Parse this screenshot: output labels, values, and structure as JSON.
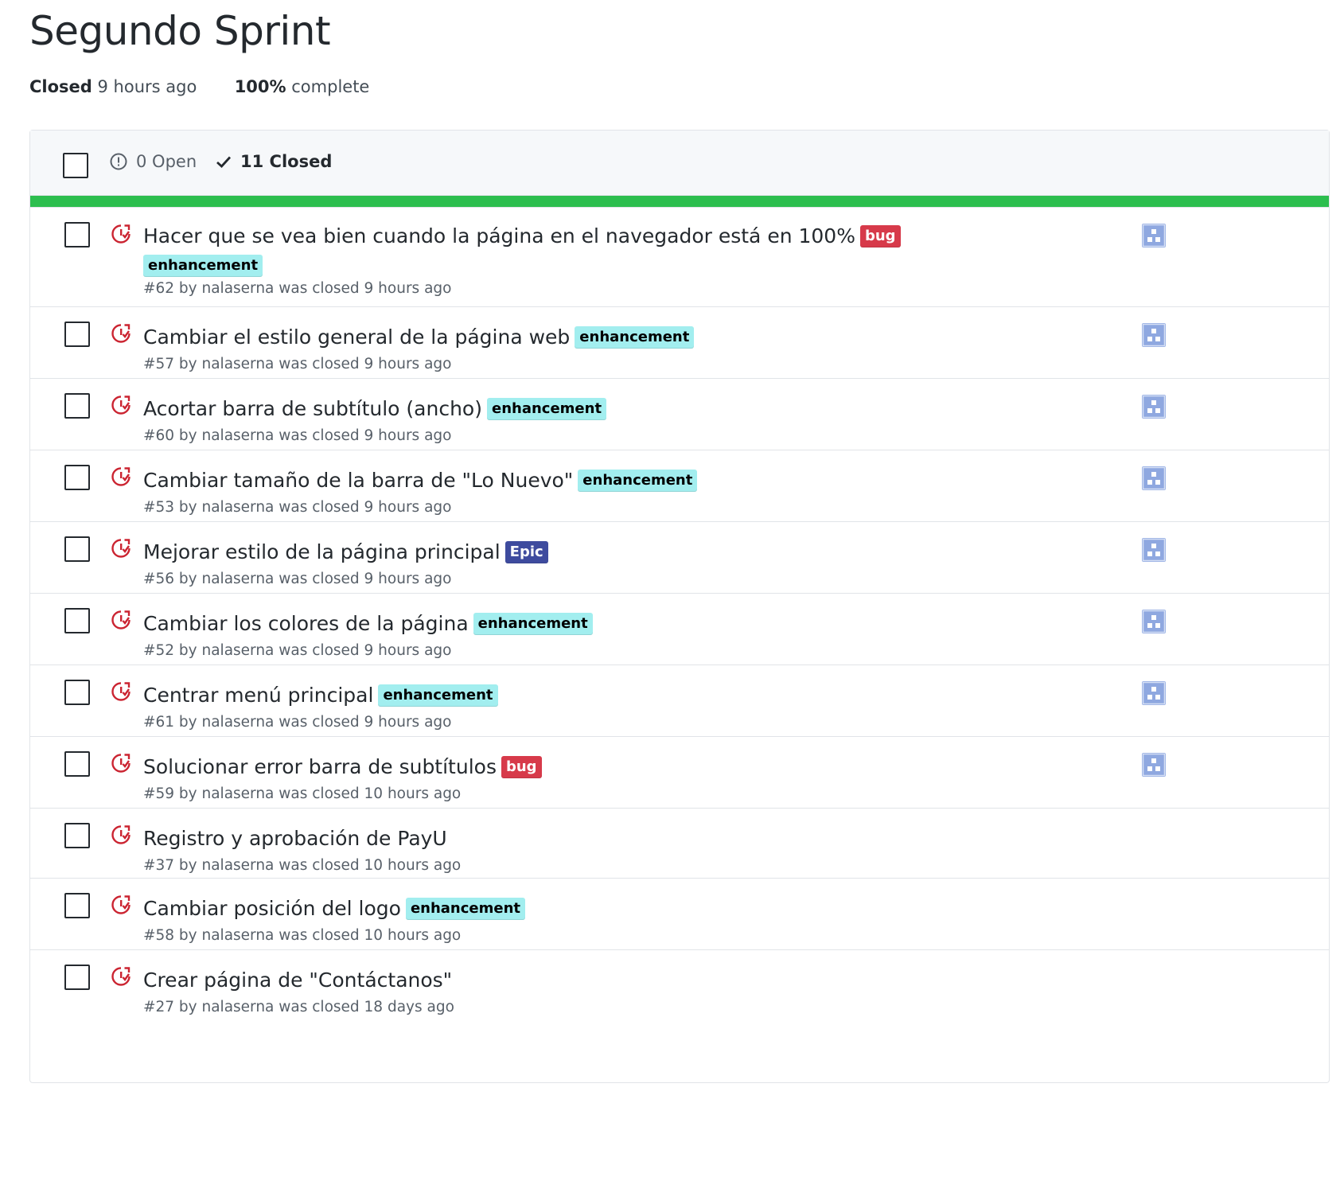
{
  "milestone": {
    "title": "Segundo Sprint",
    "status_label": "Closed",
    "status_time": "9 hours ago",
    "percent_label": "100%",
    "percent_suffix": "complete",
    "progress": 1.0
  },
  "header": {
    "open_label": "0 Open",
    "closed_label": "11 Closed"
  },
  "colors": {
    "progress": "#2cbe4e",
    "closed_icon": "#cb2431",
    "bug_bg": "#d73a4a",
    "bug_fg": "#ffffff",
    "enhancement_bg": "#a2eeef",
    "enhancement_fg": "#000000",
    "epic_bg": "#3e4b9e",
    "epic_fg": "#ffffff"
  },
  "issues": [
    {
      "title": "Hacer que se vea bien cuando la página en el navegador está en 100%",
      "labels": [
        "bug",
        "enhancement"
      ],
      "subtitle": "#62 by nalaserna was closed 9 hours ago",
      "assignee_icon": "identicon-avatar"
    },
    {
      "title": "Cambiar el estilo general de la página web",
      "labels": [
        "enhancement"
      ],
      "subtitle": "#57 by nalaserna was closed 9 hours ago",
      "assignee_icon": "identicon-avatar"
    },
    {
      "title": "Acortar barra de subtítulo (ancho)",
      "labels": [
        "enhancement"
      ],
      "subtitle": "#60 by nalaserna was closed 9 hours ago",
      "assignee_icon": "identicon-avatar"
    },
    {
      "title": "Cambiar tamaño de la barra de \"Lo Nuevo\"",
      "labels": [
        "enhancement"
      ],
      "subtitle": "#53 by nalaserna was closed 9 hours ago",
      "assignee_icon": "identicon-avatar"
    },
    {
      "title": "Mejorar estilo de la página principal",
      "labels": [
        "Epic"
      ],
      "subtitle": "#56 by nalaserna was closed 9 hours ago",
      "assignee_icon": "identicon-avatar"
    },
    {
      "title": "Cambiar los colores de la página",
      "labels": [
        "enhancement"
      ],
      "subtitle": "#52 by nalaserna was closed 9 hours ago",
      "assignee_icon": "identicon-avatar"
    },
    {
      "title": "Centrar menú principal",
      "labels": [
        "enhancement"
      ],
      "subtitle": "#61 by nalaserna was closed 9 hours ago",
      "assignee_icon": "identicon-avatar"
    },
    {
      "title": "Solucionar error barra de subtítulos",
      "labels": [
        "bug"
      ],
      "subtitle": "#59 by nalaserna was closed 10 hours ago",
      "assignee_icon": "identicon-avatar"
    },
    {
      "title": "Registro y aprobación de PayU",
      "labels": [],
      "subtitle": "#37 by nalaserna was closed 10 hours ago",
      "assignee_icon": ""
    },
    {
      "title": "Cambiar posición del logo",
      "labels": [
        "enhancement"
      ],
      "subtitle": "#58 by nalaserna was closed 10 hours ago",
      "assignee_icon": ""
    },
    {
      "title": "Crear página de \"Contáctanos\"",
      "labels": [],
      "subtitle": "#27 by nalaserna was closed 18 days ago",
      "assignee_icon": ""
    }
  ]
}
